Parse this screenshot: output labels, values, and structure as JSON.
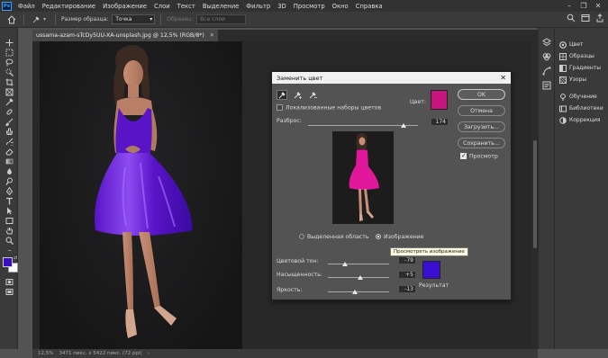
{
  "menubar": {
    "logo": "Ps",
    "items": [
      "Файл",
      "Редактирование",
      "Изображение",
      "Слои",
      "Текст",
      "Выделение",
      "Фильтр",
      "3D",
      "Просмотр",
      "Окно",
      "Справка"
    ]
  },
  "options": {
    "sample_size_label": "Размер образца:",
    "sample_size_value": "Точка",
    "samples_label": "Образец:",
    "samples_value": "Все слои"
  },
  "document": {
    "tab_title": "ussama-azam-sTcDy5UU-XA-unsplash.jpg @ 12,5% (RGB/8*)",
    "zoom": "12,5%",
    "info": "3471 пикс. x 5422 пикс. (72 ppi)"
  },
  "panels": {
    "items": [
      {
        "label": "Цвет",
        "icon": "color-wheel-icon"
      },
      {
        "label": "Образцы",
        "icon": "swatches-icon"
      },
      {
        "label": "Градиенты",
        "icon": "gradient-icon"
      },
      {
        "label": "Узоры",
        "icon": "pattern-icon"
      },
      {
        "label": "Обучение",
        "icon": "bulb-icon"
      },
      {
        "label": "Библиотеки",
        "icon": "library-icon"
      },
      {
        "label": "Коррекция",
        "icon": "adjustment-icon"
      }
    ]
  },
  "dialog": {
    "title": "Заменить цвет",
    "localized_label": "Локализованные наборы цветов",
    "color_label": "Цвет:",
    "fuzziness_label": "Разброс:",
    "fuzziness_value": "174",
    "fuzziness": 174,
    "fuzziness_max": 200,
    "selection_label": "Выделенная область",
    "image_label": "Изображение",
    "tooltip": "Просмотреть изображение",
    "hue_label": "Цветовой тон:",
    "hue_value": "-79",
    "hue": -79,
    "saturation_label": "Насыщенность:",
    "saturation_value": "+5",
    "saturation": 5,
    "lightness_label": "Яркость:",
    "lightness_value": "-13",
    "lightness": -13,
    "result_label": "Результат",
    "buttons": {
      "ok": "OK",
      "cancel": "Отмена",
      "load": "Загрузить...",
      "save": "Сохранить..."
    },
    "preview_label": "Просмотр",
    "sample_color": "#c8147f",
    "result_color": "#3a0fd2"
  },
  "colors": {
    "foreground": "#3a0fbf",
    "background": "#ffffff",
    "dress_purple": "#5a14c8",
    "dress_pink": "#e0179a"
  }
}
